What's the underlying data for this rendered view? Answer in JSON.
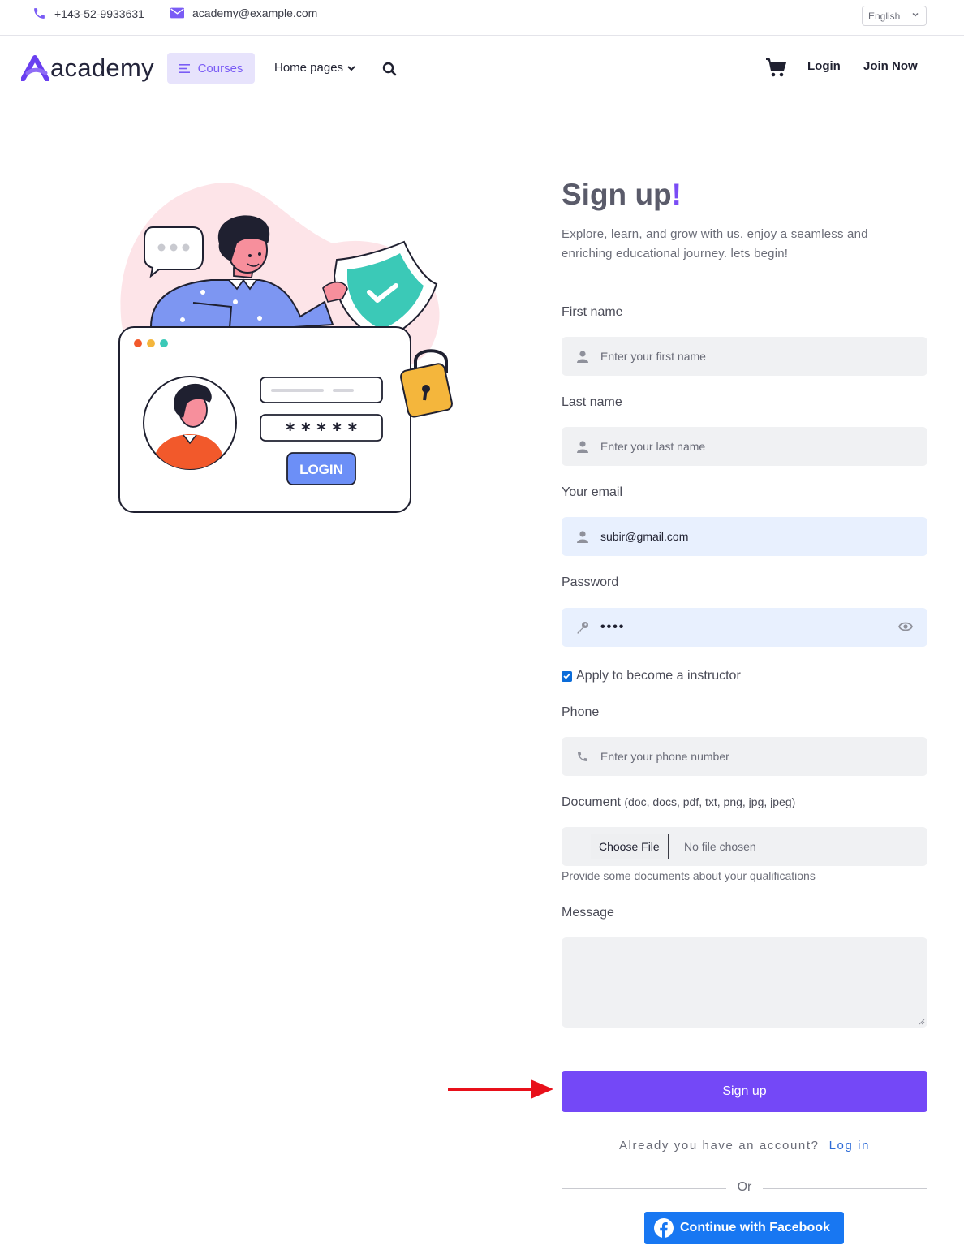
{
  "topbar": {
    "phone": "+143-52-9933631",
    "email": "academy@example.com",
    "language": "English"
  },
  "nav": {
    "logo_text": "academy",
    "courses_label": "Courses",
    "home_pages_label": "Home pages",
    "login_label": "Login",
    "join_label": "Join Now"
  },
  "illustration": {
    "login_button_text": "LOGIN",
    "password_mask": "* * * * *"
  },
  "form": {
    "title": "Sign up",
    "title_mark": "!",
    "subtitle": "Explore, learn, and grow with us. enjoy a seamless and enriching educational journey. lets begin!",
    "first_name_label": "First name",
    "first_name_placeholder": "Enter your first name",
    "last_name_label": "Last name",
    "last_name_placeholder": "Enter your last name",
    "email_label": "Your email",
    "email_value": "subir@gmail.com",
    "password_label": "Password",
    "password_value": "••••",
    "instructor_checkbox_label": "Apply to become a instructor",
    "instructor_checked": true,
    "phone_label": "Phone",
    "phone_placeholder": "Enter your phone number",
    "document_label": "Document",
    "document_types": "(doc, docs, pdf, txt, png, jpg, jpeg)",
    "choose_file_label": "Choose File",
    "no_file_text": "No file chosen",
    "document_helper": "Provide some documents about your qualifications",
    "message_label": "Message",
    "message_value": "",
    "submit_label": "Sign up",
    "already_text": "Already you have an account?",
    "login_link": "Log in",
    "or_text": "Or",
    "facebook_label": "Continue with Facebook"
  },
  "colors": {
    "accent": "#7448f7",
    "link": "#2f6cd7",
    "facebook": "#1877f2",
    "annotation_arrow": "#e8101a"
  }
}
